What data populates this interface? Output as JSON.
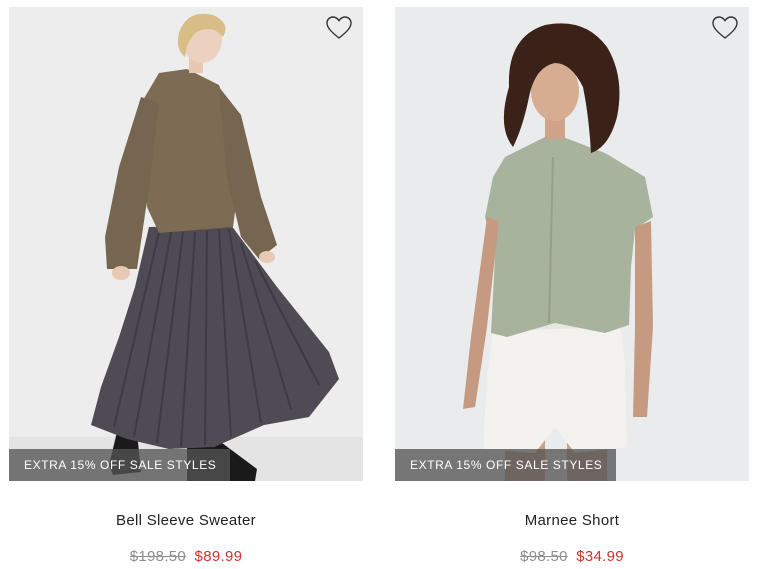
{
  "products": [
    {
      "name": "Bell Sleeve Sweater",
      "original_price": "$198.50",
      "sale_price": "$89.99",
      "promo_badge": "EXTRA 15% OFF SALE STYLES",
      "wishlist_icon": "heart-outline-icon"
    },
    {
      "name": "Marnee Short",
      "original_price": "$98.50",
      "sale_price": "$34.99",
      "promo_badge": "EXTRA 15% OFF SALE STYLES",
      "wishlist_icon": "heart-outline-icon"
    }
  ],
  "colors": {
    "sale_price": "#d0312d",
    "original_price": "#8e8e8e",
    "badge_background": "#555555"
  }
}
